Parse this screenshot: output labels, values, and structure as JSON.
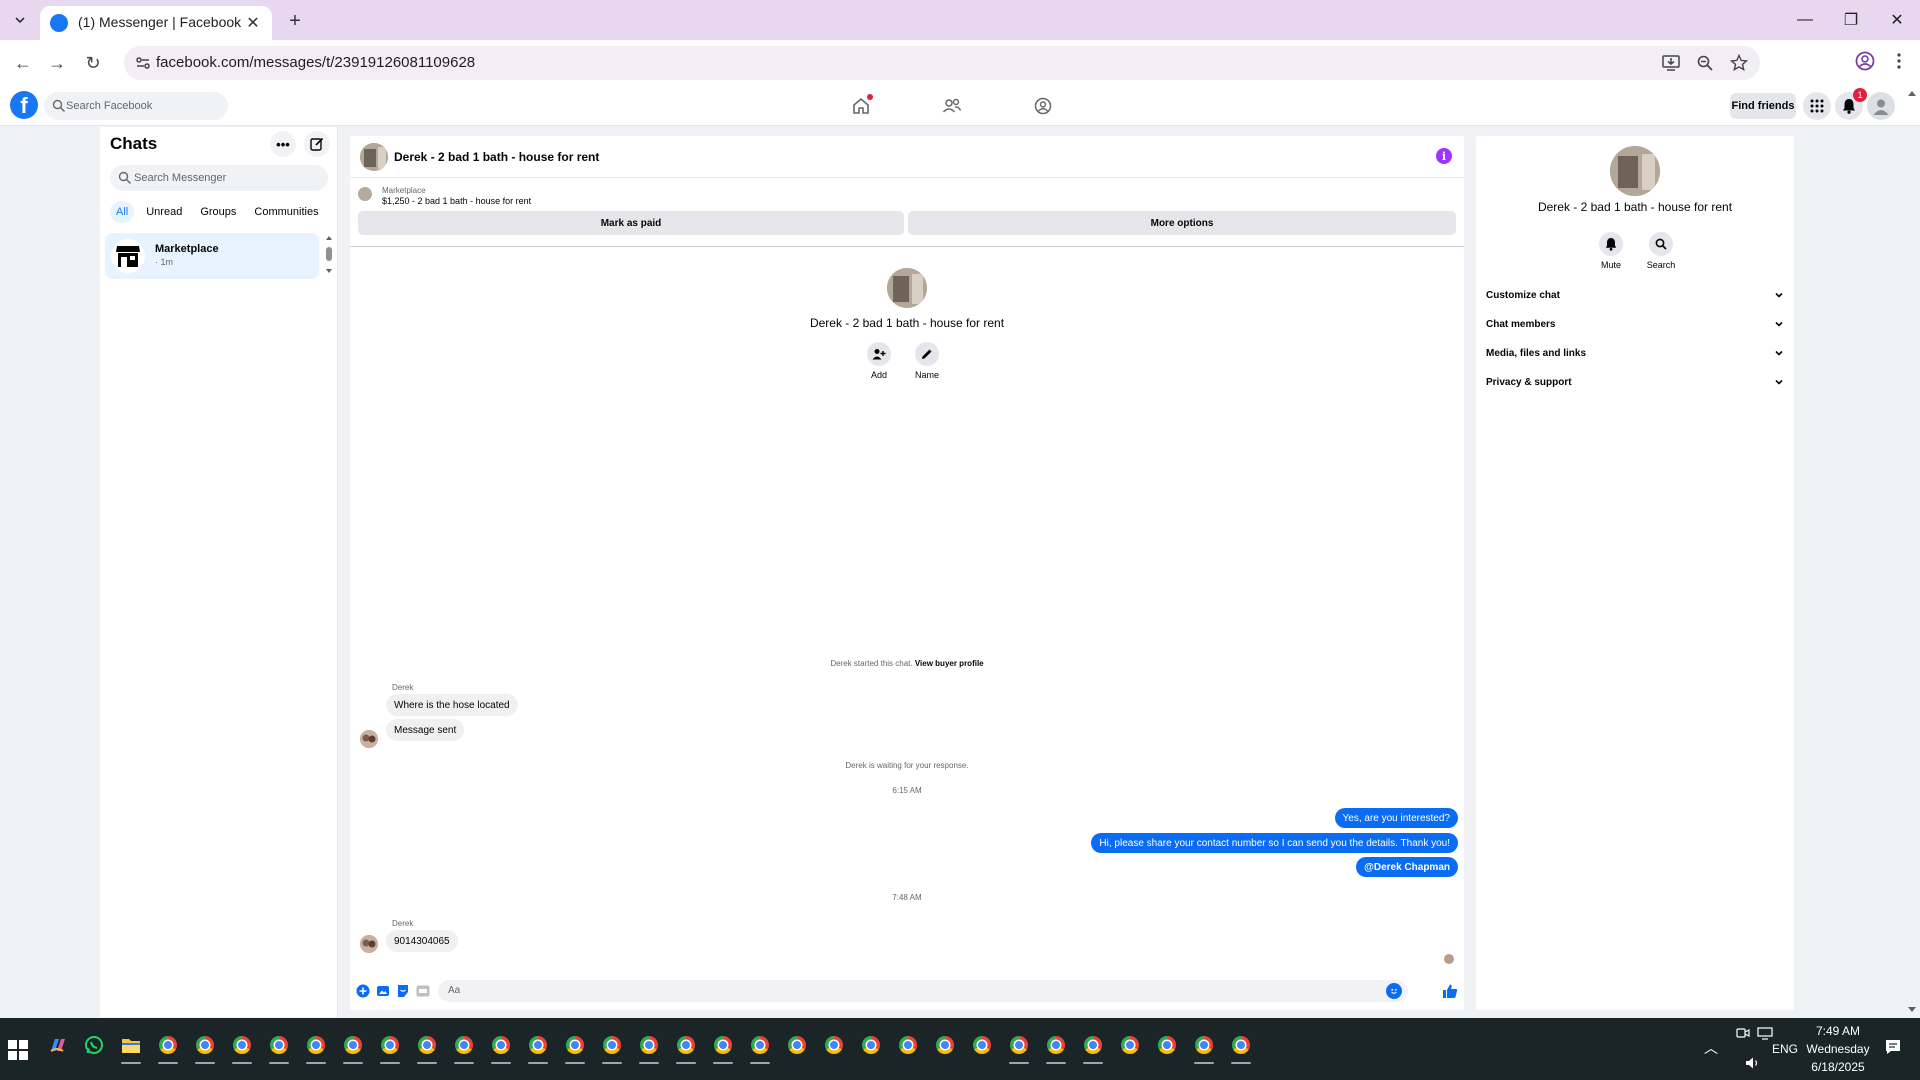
{
  "browser": {
    "tab_title": "(1) Messenger | Facebook",
    "url": "facebook.com/messages/t/23919126081109628"
  },
  "fb_header": {
    "search_placeholder": "Search Facebook",
    "find_friends": "Find friends",
    "notification_count": "1"
  },
  "chats": {
    "title": "Chats",
    "more_label": "•••",
    "search_placeholder": "Search Messenger",
    "filters": [
      "All",
      "Unread",
      "Groups",
      "Communities"
    ],
    "items": [
      {
        "name": "Marketplace",
        "time": "· 1m"
      }
    ]
  },
  "conversation": {
    "title": "Derek - 2 bad 1 bath - house for rent",
    "info_glyph": "i",
    "marketplace": {
      "label": "Marketplace",
      "listing": "$1,250 - 2 bad 1 bath - house for rent",
      "mark_paid": "Mark as paid",
      "more_options": "More options"
    },
    "intro": {
      "name": "Derek - 2 bad 1 bath - house for rent",
      "add_label": "Add",
      "name_label": "Name"
    },
    "started": {
      "text": "Derek started this chat.",
      "link": "View buyer profile"
    },
    "sender_name_1": "Derek",
    "incoming_1": [
      "Where is the hose located",
      "Message sent"
    ],
    "waiting_text": "Derek is waiting for your response.",
    "time_1": "6:15 AM",
    "outgoing": [
      "Yes, are you interested?",
      "Hi, please share your contact number so I can send you the details. Thank you!",
      "@Derek Chapman"
    ],
    "time_2": "7:48 AM",
    "sender_name_2": "Derek",
    "incoming_2": [
      "9014304065"
    ],
    "composer_placeholder": "Aa"
  },
  "info_panel": {
    "name": "Derek - 2 bad 1 bath - house for rent",
    "mute_label": "Mute",
    "search_label": "Search",
    "sections": [
      "Customize chat",
      "Chat members",
      "Media, files and links",
      "Privacy & support"
    ]
  },
  "taskbar": {
    "lang": "ENG",
    "time": "7:49 AM",
    "day": "Wednesday",
    "date": "6/18/2025"
  },
  "colors": {
    "brand": "#1877f2",
    "outgoing_bubble": "#0a6cf2",
    "info_accent": "#a033ff",
    "badge": "#e41e3f"
  }
}
